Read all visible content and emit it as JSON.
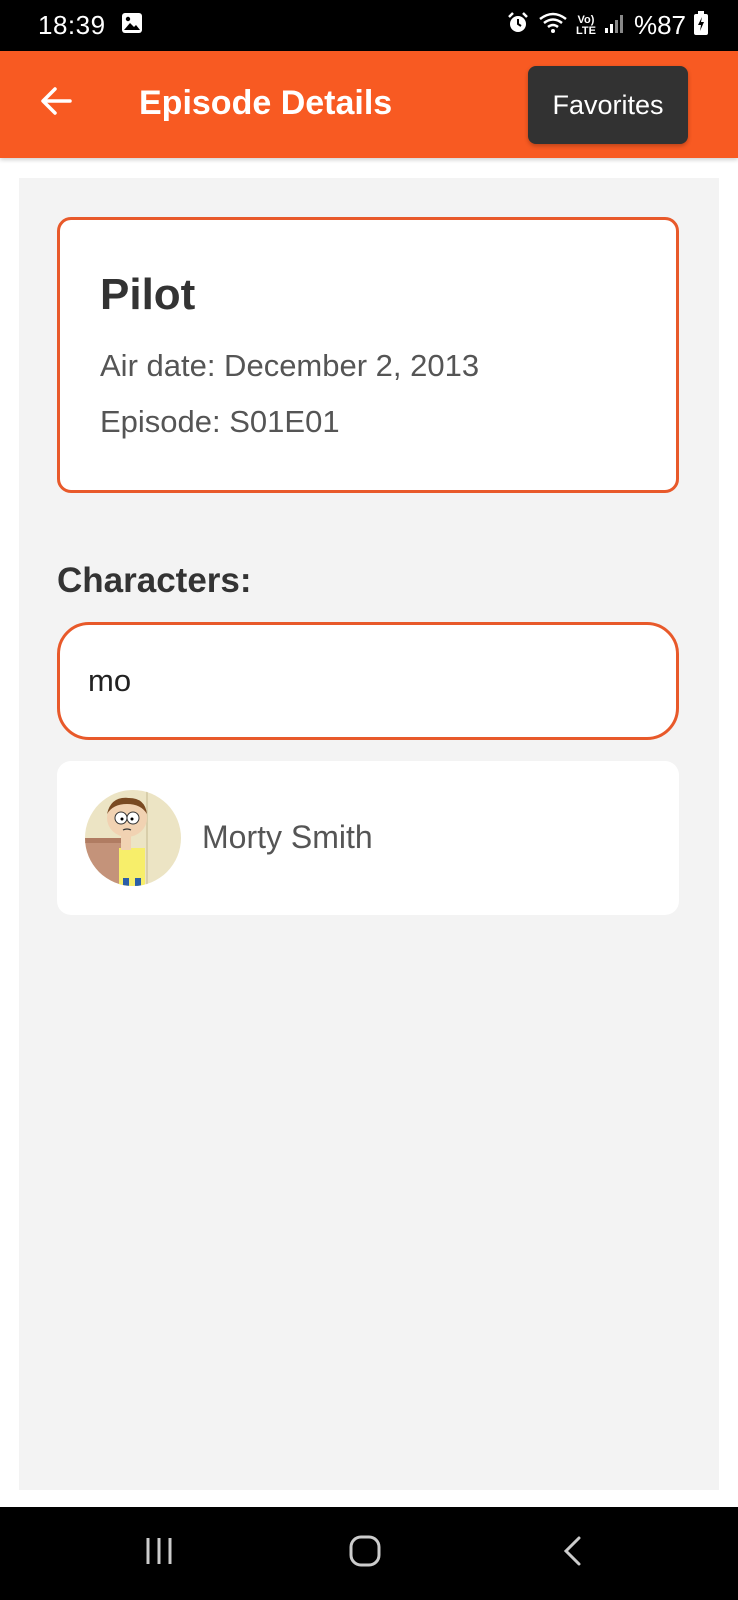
{
  "status_bar": {
    "time": "18:39",
    "volte_line1": "Vo)",
    "volte_line2": "LTE",
    "battery": "%87"
  },
  "app_bar": {
    "title": "Episode Details",
    "favorites_label": "Favorites",
    "accent_color": "#f85a22"
  },
  "episode": {
    "name": "Pilot",
    "air_date": "Air date: December 2, 2013",
    "code": "Episode: S01E01"
  },
  "characters": {
    "heading": "Characters:",
    "search_value": "mo",
    "results": [
      {
        "name": "Morty Smith",
        "avatar_icon": "morty-avatar"
      }
    ]
  },
  "icons": {
    "back": "arrow-left-icon",
    "gallery": "image-icon",
    "alarm": "alarm-icon",
    "wifi": "wifi-icon",
    "signal": "signal-icon",
    "battery": "battery-charging-icon",
    "nav_recents": "recents-icon",
    "nav_home": "home-icon",
    "nav_back": "chevron-left-icon"
  }
}
